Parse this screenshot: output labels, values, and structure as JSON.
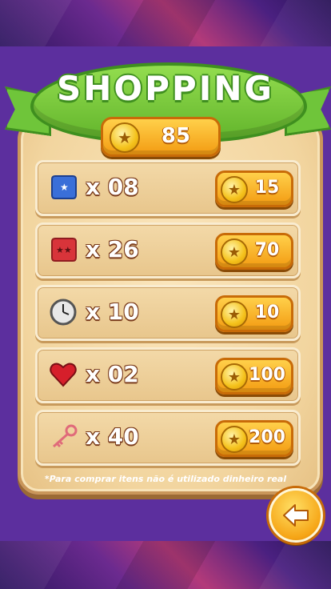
{
  "header": {
    "title": "SHOPPING"
  },
  "balance": {
    "value": "85",
    "icon": "star-coin-icon"
  },
  "items": [
    {
      "name": "scroll-blue",
      "icon": "blue-scroll-icon",
      "quantity": "x 08",
      "price": "15"
    },
    {
      "name": "scroll-red",
      "icon": "red-scroll-icon",
      "quantity": "x 26",
      "price": "70"
    },
    {
      "name": "clock",
      "icon": "clock-icon",
      "quantity": "x 10",
      "price": "10"
    },
    {
      "name": "heart",
      "icon": "heart-icon",
      "quantity": "x 02",
      "price": "100"
    },
    {
      "name": "key",
      "icon": "key-icon",
      "quantity": "x 40",
      "price": "200"
    }
  ],
  "footer": {
    "note": "*Para comprar itens não é utilizado dinheiro real"
  },
  "colors": {
    "ribbon": "#6fc53a",
    "button": "#f39b12",
    "panel": "#5c2f9e",
    "card": "#f2d59f"
  }
}
